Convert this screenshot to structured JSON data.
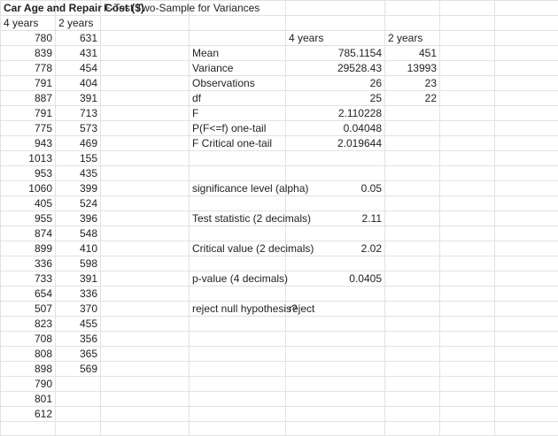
{
  "title": "Car Age and Repair Cost ($)",
  "ftest_title": "F-Test Two-Sample for Variances",
  "headers": {
    "four": "4 years",
    "two": "2 years"
  },
  "four_years": [
    "780",
    "839",
    "778",
    "791",
    "887",
    "791",
    "775",
    "943",
    "1013",
    "953",
    "1060",
    "405",
    "955",
    "874",
    "899",
    "336",
    "733",
    "654",
    "507",
    "823",
    "708",
    "808",
    "898",
    "790",
    "801",
    "612"
  ],
  "two_years": [
    "631",
    "431",
    "454",
    "404",
    "391",
    "713",
    "573",
    "469",
    "155",
    "435",
    "399",
    "524",
    "396",
    "548",
    "410",
    "598",
    "391",
    "336",
    "370",
    "455",
    "356",
    "365",
    "569"
  ],
  "ftest": {
    "col1": "4 years",
    "col2": "2 years",
    "rows": [
      {
        "label": "Mean",
        "v1": "785.1154",
        "v2": "451"
      },
      {
        "label": "Variance",
        "v1": "29528.43",
        "v2": "13993"
      },
      {
        "label": "Observations",
        "v1": "26",
        "v2": "23"
      },
      {
        "label": "df",
        "v1": "25",
        "v2": "22"
      },
      {
        "label": "F",
        "v1": "2.110228",
        "v2": ""
      },
      {
        "label": "P(F<=f) one-tail",
        "v1": "0.04048",
        "v2": ""
      },
      {
        "label": "F Critical one-tail",
        "v1": "2.019644",
        "v2": ""
      }
    ]
  },
  "results": {
    "alpha_label": "significance level (alpha)",
    "alpha": "0.05",
    "stat_label": "Test statistic (2 decimals)",
    "stat": "2.11",
    "crit_label": "Critical value (2 decimals)",
    "crit": "2.02",
    "p_label": "p-value (4 decimals)",
    "p": "0.0405",
    "reject_label": "reject null hypothesis?",
    "reject": "reject"
  }
}
